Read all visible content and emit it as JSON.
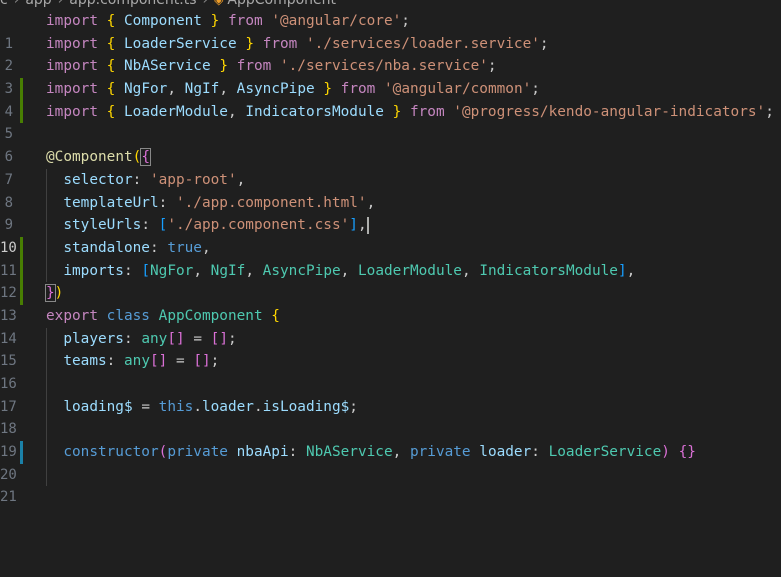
{
  "breadcrumb": {
    "seg0": "c",
    "seg1": "app",
    "seg2": "app.component.ts",
    "seg3": "AppComponent"
  },
  "lines": {
    "n1": "1",
    "n2": "2",
    "n3": "3",
    "n4": "4",
    "n5": "5",
    "n6": "6",
    "n7": "7",
    "n8": "8",
    "n9": "9",
    "n10": "10",
    "n11": "11",
    "n12": "12",
    "n13": "13",
    "n14": "14",
    "n15": "15",
    "n16": "16",
    "n17": "17",
    "n18": "18",
    "n19": "19",
    "n20": "20",
    "n21": "21"
  },
  "code": {
    "kw_import": "import",
    "kw_from": "from",
    "kw_export": "export",
    "kw_class": "class",
    "kw_true": "true",
    "kw_this": "this",
    "kw_private": "private",
    "kw_constructor": "constructor",
    "t_any": "any",
    "Component": "Component",
    "LoaderService": "LoaderService",
    "NbAService": "NbAService",
    "NgFor": "NgFor",
    "NgIf": "NgIf",
    "AsyncPipe": "AsyncPipe",
    "LoaderModule": "LoaderModule",
    "IndicatorsModule": "IndicatorsModule",
    "AppComponent": "AppComponent",
    "s_core": "'@angular/core'",
    "s_loader": "'./services/loader.service'",
    "s_nba": "'./services/nba.service'",
    "s_common": "'@angular/common'",
    "s_kendo": "'@progress/kendo-angular-indicators'",
    "s_root": "'app-root'",
    "s_html": "'./app.component.html'",
    "s_css": "'./app.component.css'",
    "at": "@",
    "selector": "selector",
    "templateUrl": "templateUrl",
    "styleUrls": "styleUrls",
    "standalone": "standalone",
    "imports": "imports",
    "players": "players",
    "teams": "teams",
    "loading": "loading$",
    "loader": "loader",
    "isLoading": "isLoading$",
    "nbaApi": "nbaApi"
  }
}
